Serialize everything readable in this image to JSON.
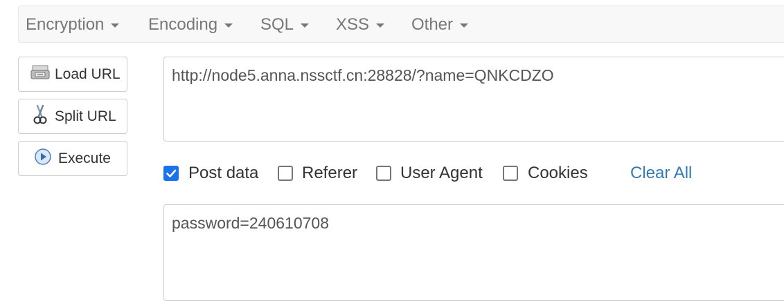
{
  "menu": {
    "items": [
      {
        "label": "Encryption"
      },
      {
        "label": "Encoding"
      },
      {
        "label": "SQL"
      },
      {
        "label": "XSS"
      },
      {
        "label": "Other"
      }
    ]
  },
  "sidebar": {
    "load_url": {
      "label": "Load URL",
      "icon": "load-url-icon"
    },
    "split_url": {
      "label": "Split URL",
      "icon": "scissors-icon"
    },
    "execute": {
      "label": "Execute",
      "icon": "play-icon"
    }
  },
  "url_field": {
    "value": "http://node5.anna.nssctf.cn:28828/?name=QNKCDZO"
  },
  "options": {
    "post_data": {
      "label": "Post data",
      "checked": true
    },
    "referer": {
      "label": "Referer",
      "checked": false
    },
    "user_agent": {
      "label": "User Agent",
      "checked": false
    },
    "cookies": {
      "label": "Cookies",
      "checked": false
    },
    "clear_all": "Clear All"
  },
  "post_field": {
    "value": "password=240610708"
  },
  "colors": {
    "accent": "#1a73e8",
    "link": "#337ab7",
    "menu_text": "#777777"
  }
}
